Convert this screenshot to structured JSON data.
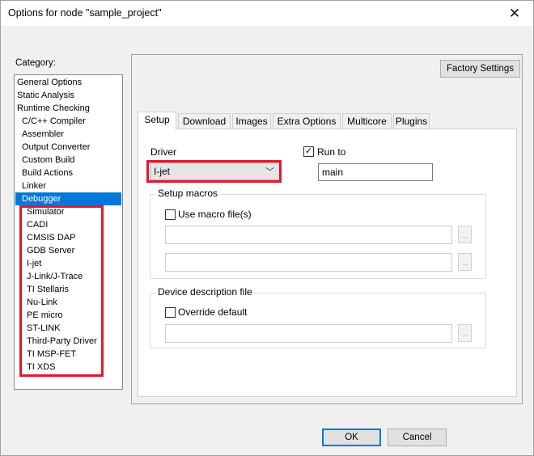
{
  "window": {
    "title": "Options for node \"sample_project\"",
    "close_glyph": "✕"
  },
  "category": {
    "label": "Category:",
    "items": [
      {
        "label": "General Options"
      },
      {
        "label": "Static Analysis"
      },
      {
        "label": "Runtime Checking"
      },
      {
        "label": "C/C++ Compiler"
      },
      {
        "label": "Assembler"
      },
      {
        "label": "Output Converter"
      },
      {
        "label": "Custom Build"
      },
      {
        "label": "Build Actions"
      },
      {
        "label": "Linker"
      },
      {
        "label": "Debugger"
      },
      {
        "label": "Simulator"
      },
      {
        "label": "CADI"
      },
      {
        "label": "CMSIS DAP"
      },
      {
        "label": "GDB Server"
      },
      {
        "label": "I-jet"
      },
      {
        "label": "J-Link/J-Trace"
      },
      {
        "label": "TI Stellaris"
      },
      {
        "label": "Nu-Link"
      },
      {
        "label": "PE micro"
      },
      {
        "label": "ST-LINK"
      },
      {
        "label": "Third-Party Driver"
      },
      {
        "label": "TI MSP-FET"
      },
      {
        "label": "TI XDS"
      }
    ],
    "selected": "Debugger"
  },
  "factory_settings_label": "Factory Settings",
  "tabs": [
    {
      "label": "Setup"
    },
    {
      "label": "Download"
    },
    {
      "label": "Images"
    },
    {
      "label": "Extra Options"
    },
    {
      "label": "Multicore"
    },
    {
      "label": "Plugins"
    }
  ],
  "setup": {
    "driver_label": "Driver",
    "driver_value": "I-jet",
    "run_to_label": "Run to",
    "run_to_checked": true,
    "run_to_value": "main",
    "setup_macros_title": "Setup macros",
    "use_macro_label": "Use macro file(s)",
    "use_macro_checked": false,
    "browse_label": "...",
    "device_desc_title": "Device description file",
    "override_label": "Override default",
    "override_checked": false
  },
  "footer": {
    "ok_label": "OK",
    "cancel_label": "Cancel"
  },
  "colors": {
    "selection": "#0078d7",
    "highlight_box": "#e3182d"
  }
}
